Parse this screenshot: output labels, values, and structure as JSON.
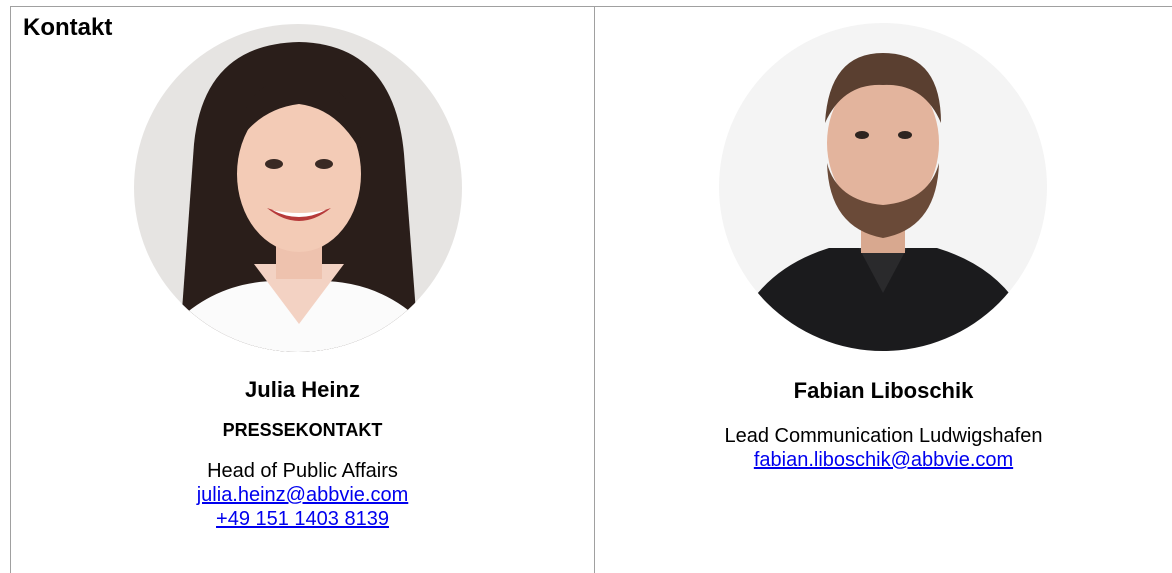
{
  "heading": "Kontakt",
  "contacts": [
    {
      "name": "Julia Heinz",
      "tag": "PRESSEKONTAKT",
      "title": "Head of Public Affairs",
      "email": "julia.heinz@abbvie.com",
      "phone": "+49 151 1403 8139"
    },
    {
      "name": "Fabian Liboschik",
      "title": "Lead Communication Ludwigshafen",
      "email": "fabian.liboschik@abbvie.com"
    }
  ],
  "colors": {
    "link": "#0000ee",
    "border": "#a0a0a0"
  }
}
